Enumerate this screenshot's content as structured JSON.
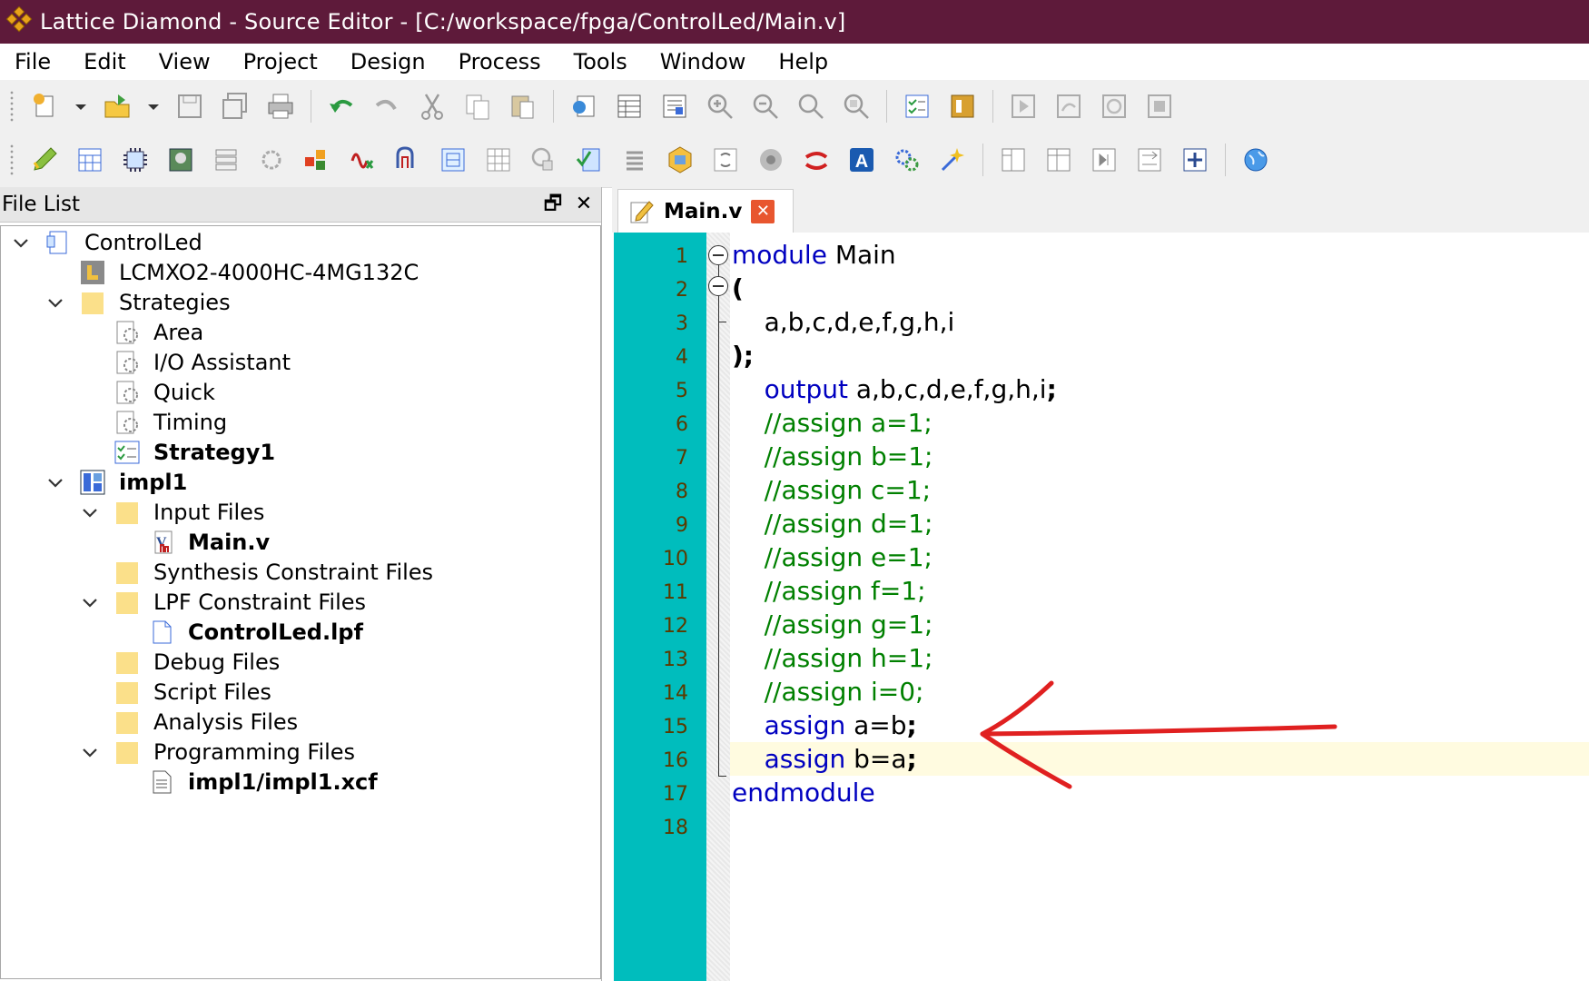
{
  "window": {
    "title": "Lattice Diamond - Source Editor - [C:/workspace/fpga/ControlLed/Main.v]"
  },
  "menu": [
    "File",
    "Edit",
    "View",
    "Project",
    "Design",
    "Process",
    "Tools",
    "Window",
    "Help"
  ],
  "toolbar1_icons": [
    "new-file-icon",
    "open-file-icon",
    "save-icon",
    "save-all-icon",
    "print-icon",
    "undo-icon",
    "redo-icon",
    "cut-icon",
    "copy-icon",
    "paste-icon",
    "browser-icon",
    "table-icon",
    "report-icon",
    "zoom-in-icon",
    "zoom-out-icon",
    "zoom-fit-icon",
    "zoom-area-icon",
    "checklist-icon",
    "netlist-icon",
    "run-icon",
    "step-icon",
    "refresh-icon",
    "stop-icon"
  ],
  "toolbar2_icons": [
    "pencil-icon",
    "spreadsheet-icon",
    "chip-icon",
    "package-icon",
    "list-icon",
    "gear-chip-icon",
    "floorplan-icon",
    "power-icon",
    "timing-icon",
    "netview-icon",
    "grid-icon",
    "analyzer-icon",
    "file-check-icon",
    "stack-icon",
    "module-icon",
    "sync-icon",
    "debug-icon",
    "lattice-icon",
    "font-icon",
    "gears-icon",
    "wand-icon",
    "split-icon",
    "layout-icon",
    "skip-icon",
    "flow-icon",
    "import-icon",
    "web-icon"
  ],
  "file_list": {
    "title": "File List",
    "restore_label": "🗗",
    "close_label": "✕",
    "tree": [
      {
        "label": "ControlLed",
        "bold": false
      },
      {
        "label": "LCMXO2-4000HC-4MG132C",
        "bold": false
      },
      {
        "label": "Strategies",
        "bold": false
      },
      {
        "label": "Area",
        "bold": false
      },
      {
        "label": "I/O Assistant",
        "bold": false
      },
      {
        "label": "Quick",
        "bold": false
      },
      {
        "label": "Timing",
        "bold": false
      },
      {
        "label": "Strategy1",
        "bold": true
      },
      {
        "label": "impl1",
        "bold": true
      },
      {
        "label": "Input Files",
        "bold": false
      },
      {
        "label": "Main.v",
        "bold": true
      },
      {
        "label": "Synthesis Constraint Files",
        "bold": false
      },
      {
        "label": "LPF Constraint Files",
        "bold": false
      },
      {
        "label": "ControlLed.lpf",
        "bold": true
      },
      {
        "label": "Debug Files",
        "bold": false
      },
      {
        "label": "Script Files",
        "bold": false
      },
      {
        "label": "Analysis Files",
        "bold": false
      },
      {
        "label": "Programming Files",
        "bold": false
      },
      {
        "label": "impl1/impl1.xcf",
        "bold": true
      }
    ]
  },
  "editor": {
    "tab_label": "Main.v",
    "tab_close": "✕",
    "line_numbers": [
      "1",
      "2",
      "3",
      "4",
      "5",
      "6",
      "7",
      "8",
      "9",
      "10",
      "11",
      "12",
      "13",
      "14",
      "15",
      "16",
      "17",
      "18"
    ],
    "lines": [
      [
        {
          "t": "module",
          "c": "kw"
        },
        {
          "t": " Main",
          "c": "ident"
        }
      ],
      [
        {
          "t": "(",
          "c": "semi"
        }
      ],
      [
        {
          "t": "    a,b,c,d,e,f,g,h,i",
          "c": "ident"
        }
      ],
      [
        {
          "t": ");",
          "c": "semi"
        }
      ],
      [
        {
          "t": "    output",
          "c": "kw"
        },
        {
          "t": " a,b,c,d,e,f,g,h,i",
          "c": "ident"
        },
        {
          "t": ";",
          "c": "semi"
        }
      ],
      [
        {
          "t": "    //assign a=1;",
          "c": "cmt"
        }
      ],
      [
        {
          "t": "    //assign b=1;",
          "c": "cmt"
        }
      ],
      [
        {
          "t": "    //assign c=1;",
          "c": "cmt"
        }
      ],
      [
        {
          "t": "    //assign d=1;",
          "c": "cmt"
        }
      ],
      [
        {
          "t": "    //assign e=1;",
          "c": "cmt"
        }
      ],
      [
        {
          "t": "    //assign f=1;",
          "c": "cmt"
        }
      ],
      [
        {
          "t": "    //assign g=1;",
          "c": "cmt"
        }
      ],
      [
        {
          "t": "    //assign h=1;",
          "c": "cmt"
        }
      ],
      [
        {
          "t": "    //assign i=0;",
          "c": "cmt"
        }
      ],
      [
        {
          "t": "    assign",
          "c": "kw"
        },
        {
          "t": " a=b",
          "c": "ident"
        },
        {
          "t": ";",
          "c": "semi"
        }
      ],
      [
        {
          "t": "    assign",
          "c": "kw"
        },
        {
          "t": " b=a",
          "c": "ident"
        },
        {
          "t": ";",
          "c": "semi"
        }
      ],
      [
        {
          "t": "endmodule",
          "c": "kw"
        }
      ],
      []
    ],
    "highlighted_line": 16
  },
  "colors": {
    "titlebar": "#5e1a3a",
    "gutter": "#00bdbd",
    "keyword": "#0000c0",
    "comment": "#008000",
    "highlight": "#fffbe0",
    "arrow": "#e02020"
  }
}
